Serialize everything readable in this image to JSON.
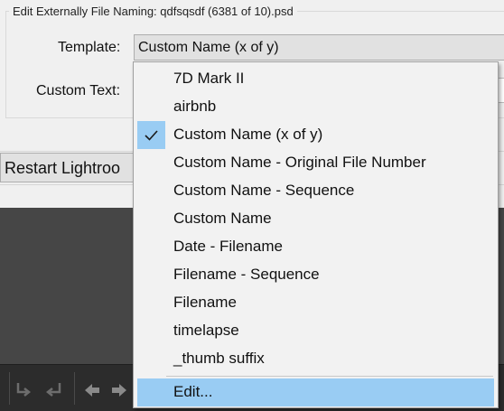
{
  "dialog": {
    "group_title": "Edit Externally File Naming:  qdfsqsdf (6381 of 10).psd",
    "template_label": "Template:",
    "template_value": "Custom Name (x of y)",
    "custom_text_label": "Custom Text:"
  },
  "restart_button": "Restart Lightroo",
  "menu": {
    "items": [
      "7D Mark II",
      "airbnb",
      "Custom Name (x of y)",
      "Custom Name - Original File Number",
      "Custom Name - Sequence",
      "Custom Name",
      "Date - Filename",
      "Filename - Sequence",
      "Filename",
      "timelapse",
      "_thumb suffix"
    ],
    "checked_item": "Custom Name (x of y)",
    "edit_label": "Edit..."
  },
  "toolbar_icons": [
    "rotate-left-icon",
    "rotate-right-icon",
    "arrow-left-icon",
    "arrow-right-icon"
  ],
  "colors": {
    "highlight": "#99ccf3",
    "dark_panel": "#464646",
    "toolbar": "#2c2c2c"
  }
}
